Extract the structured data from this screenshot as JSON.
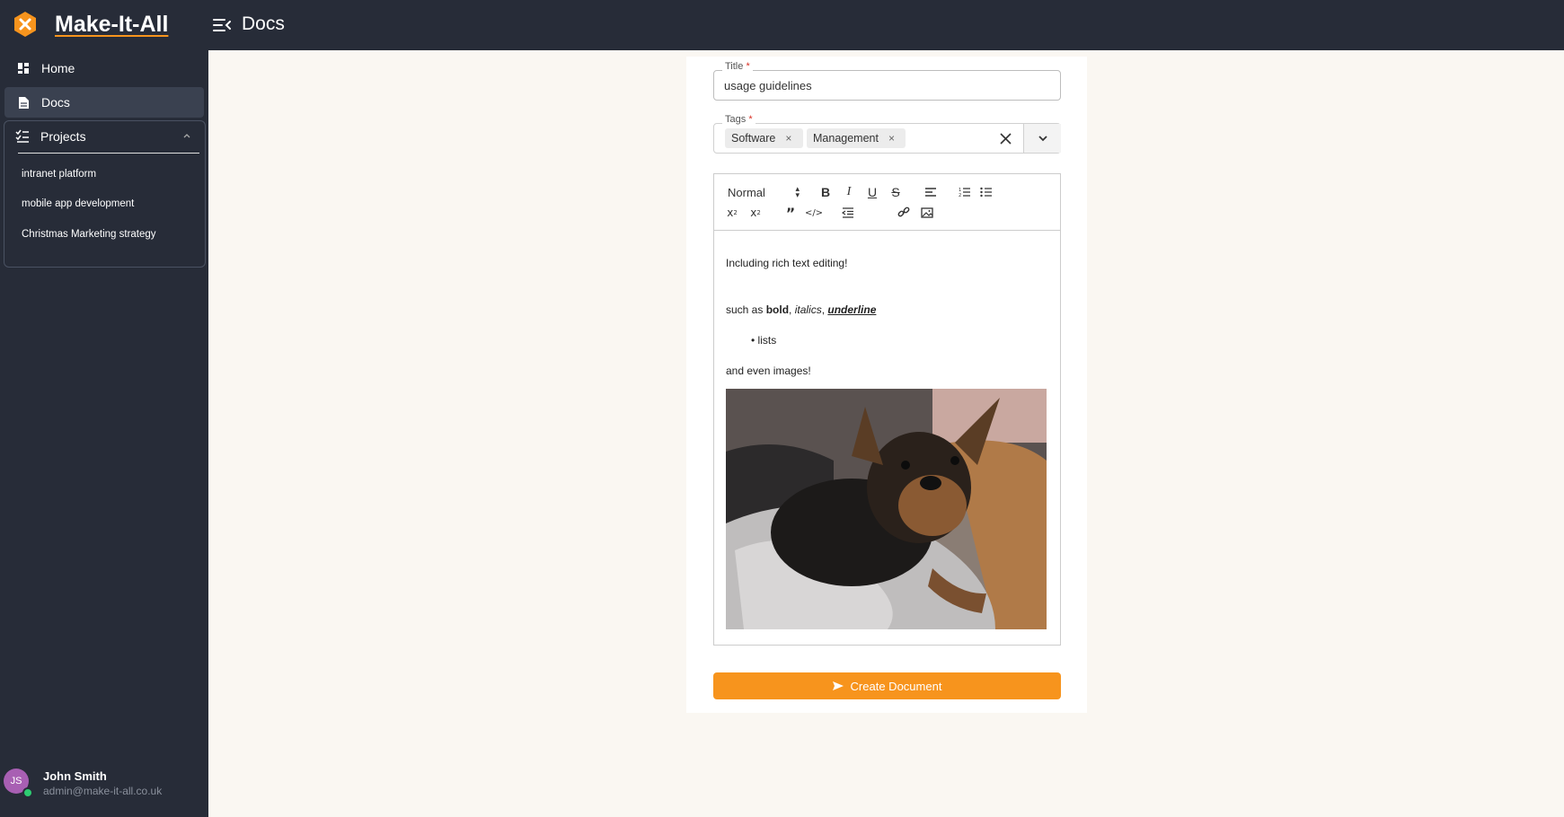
{
  "app": {
    "brand": "Make-It-All",
    "page_title": "Docs"
  },
  "sidebar": {
    "items": [
      {
        "label": "Home",
        "icon": "dashboard-icon"
      },
      {
        "label": "Docs",
        "icon": "document-icon"
      }
    ],
    "projects": {
      "label": "Projects",
      "icon": "checklist-icon",
      "items": [
        "intranet platform",
        "mobile app development",
        "Christmas Marketing strategy"
      ]
    }
  },
  "user": {
    "initials": "JS",
    "name": "John Smith",
    "email": "admin@make-it-all.co.uk"
  },
  "form": {
    "title_label": "Title",
    "title_value": "usage guidelines",
    "tags_label": "Tags",
    "required_mark": "*",
    "tags": [
      "Software",
      "Management"
    ],
    "tag_remove": "×",
    "editor": {
      "font_size": "Normal",
      "content": {
        "line1": "Including rich text editing!",
        "line2_prefix": "such as ",
        "line2_bold": "bold",
        "line2_sep1": ", ",
        "line2_italic": "italics",
        "line2_sep2": ", ",
        "line2_underline": "underline",
        "bullet": "• lists",
        "line4": "and even images!"
      }
    },
    "submit_label": "Create Document"
  },
  "colors": {
    "accent": "#f7941d",
    "sidebar_bg": "#272c38",
    "page_bg": "#faf7f2"
  }
}
